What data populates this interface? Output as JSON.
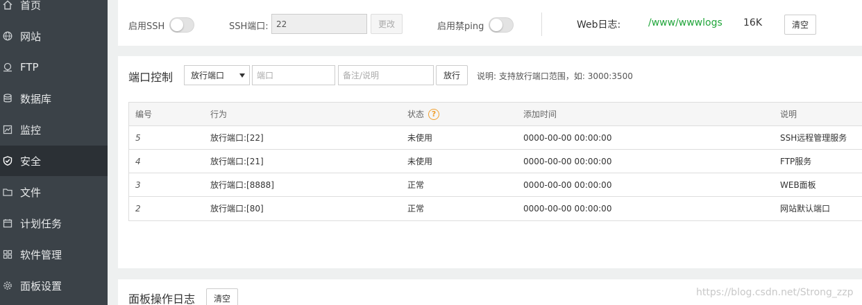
{
  "sidebar": {
    "items": [
      {
        "label": "首页",
        "icon": "home-icon"
      },
      {
        "label": "网站",
        "icon": "globe-icon"
      },
      {
        "label": "FTP",
        "icon": "ftp-icon"
      },
      {
        "label": "数据库",
        "icon": "database-icon"
      },
      {
        "label": "监控",
        "icon": "monitor-icon"
      },
      {
        "label": "安全",
        "icon": "shield-icon",
        "active": true
      },
      {
        "label": "文件",
        "icon": "folder-icon"
      },
      {
        "label": "计划任务",
        "icon": "calendar-icon"
      },
      {
        "label": "软件管理",
        "icon": "grid-icon"
      },
      {
        "label": "面板设置",
        "icon": "gear-icon"
      }
    ]
  },
  "settings": {
    "ssh_enable_label": "启用SSH",
    "ssh_port_label": "SSH端口:",
    "ssh_port_value": "22",
    "change_button": "更改",
    "ping_label": "启用禁ping",
    "weblog_label": "Web日志:",
    "weblog_path": "/www/wwwlogs",
    "weblog_size": "16K",
    "clear_button": "清空"
  },
  "port_control": {
    "title": "端口控制",
    "select_value": "放行端口",
    "port_placeholder": "端口",
    "remark_placeholder": "备注/说明",
    "allow_button": "放行",
    "hint": "说明: 支持放行端口范围，如: 3000:3500"
  },
  "table": {
    "headers": [
      "编号",
      "行为",
      "状态",
      "添加时间",
      "说明"
    ],
    "status_help_icon": "question-circle-icon",
    "rows": [
      {
        "id": "5",
        "action": "放行端口:[22]",
        "status": "未使用",
        "time": "0000-00-00 00:00:00",
        "desc": "SSH远程管理服务"
      },
      {
        "id": "4",
        "action": "放行端口:[21]",
        "status": "未使用",
        "time": "0000-00-00 00:00:00",
        "desc": "FTP服务"
      },
      {
        "id": "3",
        "action": "放行端口:[8888]",
        "status": "正常",
        "time": "0000-00-00 00:00:00",
        "desc": "WEB面板"
      },
      {
        "id": "2",
        "action": "放行端口:[80]",
        "status": "正常",
        "time": "0000-00-00 00:00:00",
        "desc": "网站默认端口"
      }
    ]
  },
  "panel_log": {
    "title": "面板操作日志",
    "clear_button": "清空"
  },
  "watermark": "https://blog.csdn.net/Strong_zzp",
  "colors": {
    "sidebar_bg": "#3b4248",
    "sidebar_active_bg": "#2b3035",
    "log_path_green": "#20a53a",
    "help_icon_orange": "#f0a030"
  }
}
